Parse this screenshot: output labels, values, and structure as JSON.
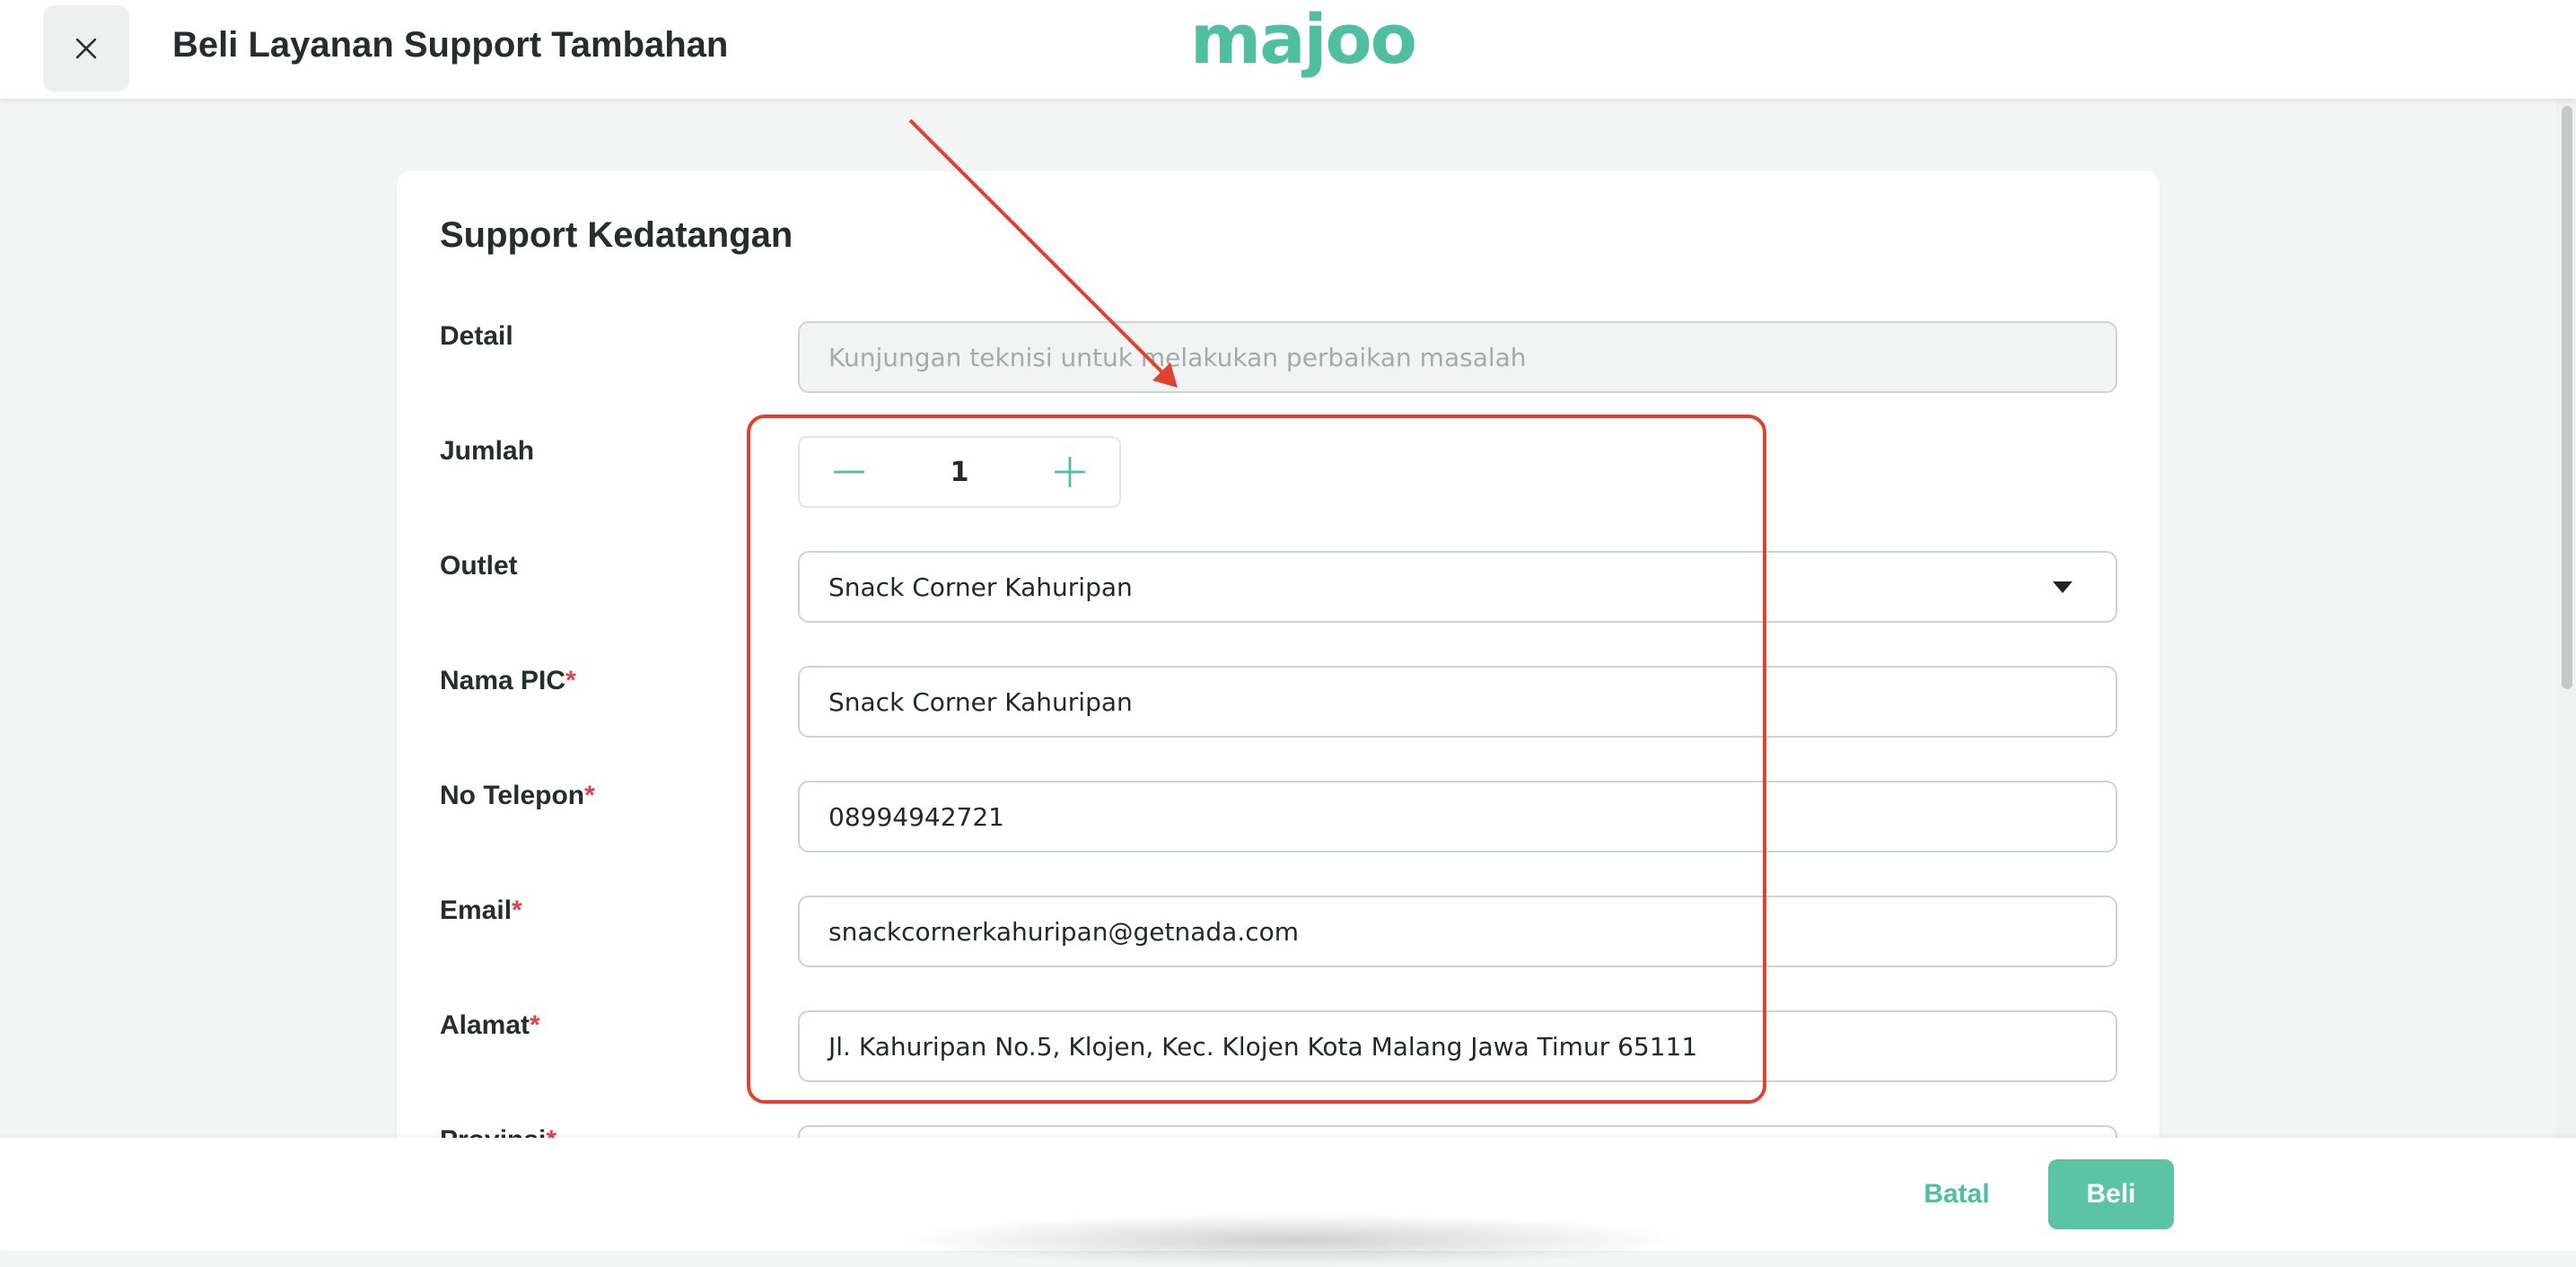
{
  "header": {
    "title": "Beli Layanan Support Tambahan",
    "logo_text": "majoo"
  },
  "form": {
    "title": "Support Kedatangan",
    "detail": {
      "label": "Detail",
      "placeholder": "Kunjungan teknisi untuk melakukan perbaikan masalah"
    },
    "quantity": {
      "label": "Jumlah",
      "value": "1"
    },
    "outlet": {
      "label": "Outlet",
      "value": "Snack Corner Kahuripan"
    },
    "pic_name": {
      "label": "Nama PIC",
      "required_mark": "*",
      "value": "Snack Corner Kahuripan"
    },
    "phone": {
      "label": "No Telepon",
      "required_mark": "*",
      "value": "08994942721"
    },
    "email": {
      "label": "Email",
      "required_mark": "*",
      "value": "snackcornerkahuripan@getnada.com"
    },
    "address": {
      "label": "Alamat",
      "required_mark": "*",
      "value": "Jl. Kahuripan No.5,  Klojen,  Kec. Klojen Kota Malang Jawa Timur 65111"
    },
    "province": {
      "label": "Provinsi",
      "required_mark": "*"
    }
  },
  "footer": {
    "cancel_label": "Batal",
    "buy_label": "Beli"
  },
  "colors": {
    "brand": "#4fbf9f",
    "button": "#5bc4a3",
    "required": "#e0424a",
    "annotation": "#e2412f"
  },
  "icons": {
    "close": "close-icon",
    "minus": "minus-icon",
    "plus": "plus-icon",
    "dropdown": "chevron-down-icon"
  }
}
